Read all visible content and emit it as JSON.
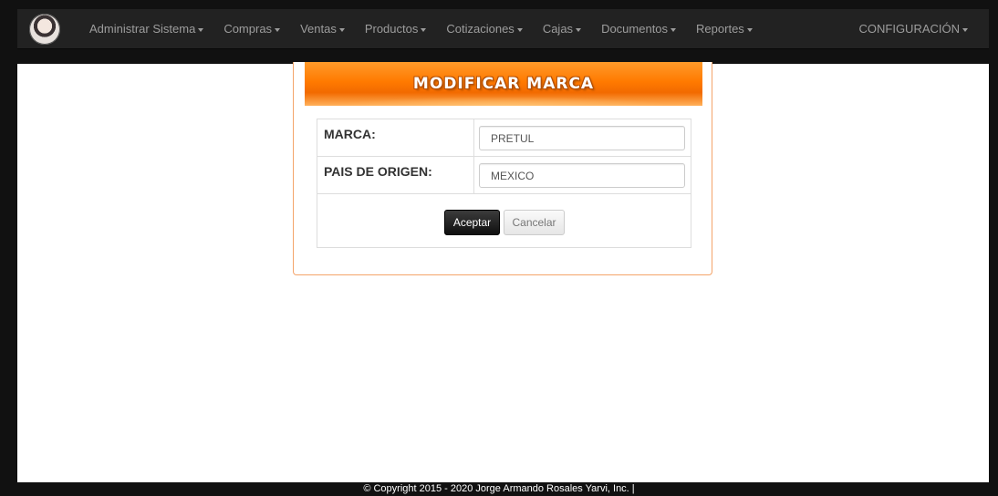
{
  "navbar": {
    "menu": [
      {
        "label": "Administrar Sistema"
      },
      {
        "label": "Compras"
      },
      {
        "label": "Ventas"
      },
      {
        "label": "Productos"
      },
      {
        "label": "Cotizaciones"
      },
      {
        "label": "Cajas"
      },
      {
        "label": "Documentos"
      },
      {
        "label": "Reportes"
      }
    ],
    "config_label": "CONFIGURACIÓN"
  },
  "panel": {
    "title": "MODIFICAR MARCA",
    "fields": [
      {
        "label": "MARCA:",
        "value": "PRETUL"
      },
      {
        "label": "PAIS DE ORIGEN:",
        "value": "MEXICO"
      }
    ],
    "accept_label": "Aceptar",
    "cancel_label": "Cancelar"
  },
  "footer": {
    "text": "© Copyright 2015 - 2020 Jorge Armando Rosales Yarvi, Inc. |"
  },
  "colors": {
    "navbar_bg": "#222222",
    "banner_orange": "#ff7a00",
    "panel_border": "#f4a46a"
  }
}
